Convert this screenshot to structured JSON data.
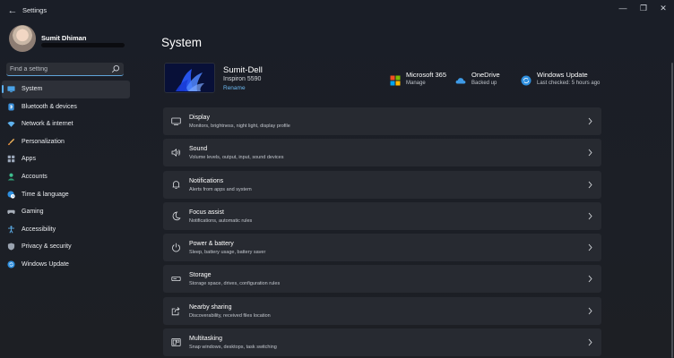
{
  "window": {
    "title": "Settings",
    "controls": {
      "minimize": "—",
      "maximize": "❐",
      "close": "✕"
    }
  },
  "profile": {
    "name": "Sumit Dhiman"
  },
  "search": {
    "placeholder": "Find a setting"
  },
  "sidebar": {
    "items": [
      {
        "label": "System",
        "icon": "monitor-icon",
        "active": true
      },
      {
        "label": "Bluetooth & devices",
        "icon": "bluetooth-icon"
      },
      {
        "label": "Network & internet",
        "icon": "wifi-icon"
      },
      {
        "label": "Personalization",
        "icon": "brush-icon"
      },
      {
        "label": "Apps",
        "icon": "apps-icon"
      },
      {
        "label": "Accounts",
        "icon": "person-icon"
      },
      {
        "label": "Time & language",
        "icon": "globe-clock-icon"
      },
      {
        "label": "Gaming",
        "icon": "gamepad-icon"
      },
      {
        "label": "Accessibility",
        "icon": "accessibility-icon"
      },
      {
        "label": "Privacy & security",
        "icon": "shield-icon"
      },
      {
        "label": "Windows Update",
        "icon": "update-icon"
      }
    ]
  },
  "main": {
    "title": "System",
    "device": {
      "name": "Sumit-Dell",
      "model": "Inspiron 5590",
      "rename": "Rename"
    },
    "services": [
      {
        "title": "Microsoft 365",
        "sub": "Manage",
        "icon": "microsoft-logo-icon"
      },
      {
        "title": "OneDrive",
        "sub": "Backed up",
        "icon": "cloud-icon"
      },
      {
        "title": "Windows Update",
        "sub": "Last checked: 5 hours ago",
        "icon": "sync-icon"
      }
    ],
    "cards": [
      {
        "title": "Display",
        "sub": "Monitors, brightness, night light, display profile",
        "icon": "display-icon"
      },
      {
        "title": "Sound",
        "sub": "Volume levels, output, input, sound devices",
        "icon": "speaker-icon"
      },
      {
        "title": "Notifications",
        "sub": "Alerts from apps and system",
        "icon": "bell-icon"
      },
      {
        "title": "Focus assist",
        "sub": "Notifications, automatic rules",
        "icon": "moon-icon"
      },
      {
        "title": "Power & battery",
        "sub": "Sleep, battery usage, battery saver",
        "icon": "power-icon"
      },
      {
        "title": "Storage",
        "sub": "Storage space, drives, configuration rules",
        "icon": "storage-icon"
      },
      {
        "title": "Nearby sharing",
        "sub": "Discoverability, received files location",
        "icon": "share-icon"
      },
      {
        "title": "Multitasking",
        "sub": "Snap windows, desktops, task switching",
        "icon": "multitask-icon"
      }
    ]
  },
  "colors": {
    "accent": "#5db0f0",
    "card": "#272a31",
    "background": "#1c1f26"
  }
}
